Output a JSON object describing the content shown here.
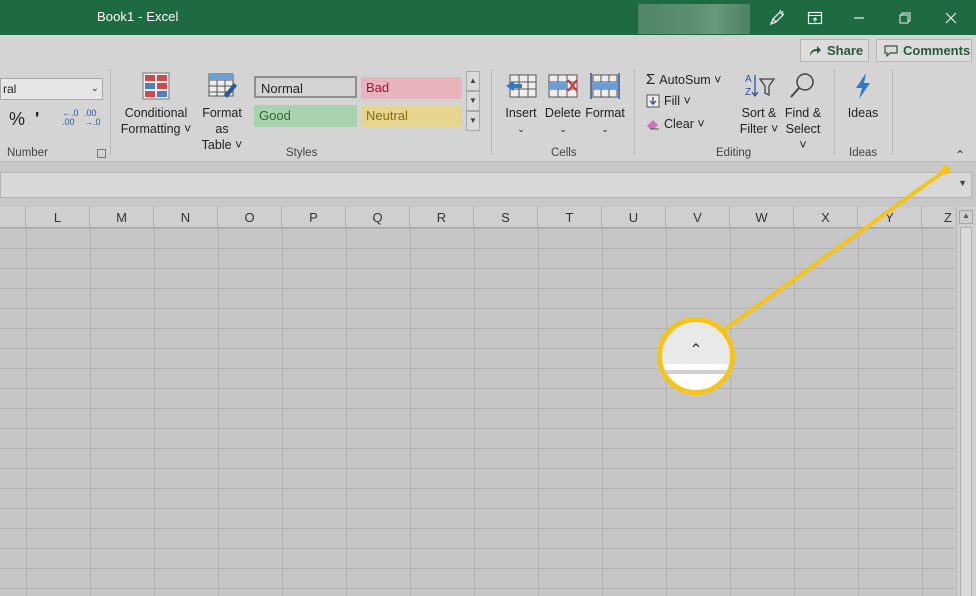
{
  "window": {
    "title": "Book1  -  Excel",
    "controls": {
      "minimize": "minimize",
      "restore": "restore",
      "close": "close"
    }
  },
  "ribbon_top": {
    "share_label": "Share",
    "comments_label": "Comments"
  },
  "ribbon": {
    "number": {
      "format_value": "ral",
      "percent": "%",
      "comma": "'",
      "increase_decimal": "←.0\n.00",
      "decrease_decimal": ".00\n→.0",
      "label": "Number"
    },
    "styles": {
      "conditional_formatting": "Conditional\nFormatting ˅",
      "format_as_table": "Format as\nTable ˅",
      "cells": [
        {
          "label": "Normal",
          "color": "#e6e6e6",
          "text_color": "#222222"
        },
        {
          "label": "Bad",
          "color": "#e7b3bc",
          "text_color": "#9c1c3a"
        },
        {
          "label": "Good",
          "color": "#a9d3ae",
          "text_color": "#2c6b2f"
        },
        {
          "label": "Neutral",
          "color": "#e5d58f",
          "text_color": "#8a6a10"
        }
      ],
      "label": "Styles"
    },
    "cells": {
      "insert": "Insert",
      "delete": "Delete",
      "format": "Format",
      "label": "Cells"
    },
    "editing": {
      "autosum": "AutoSum ˅",
      "fill": "Fill ˅",
      "clear": "Clear ˅",
      "sort_filter": "Sort &\nFilter ˅",
      "find_select": "Find &\nSelect ˅",
      "label": "Editing"
    },
    "ideas": {
      "ideas": "Ideas",
      "label": "Ideas"
    }
  },
  "columns": [
    "L",
    "M",
    "N",
    "O",
    "P",
    "Q",
    "R",
    "S",
    "T",
    "U",
    "V",
    "W",
    "X",
    "Y",
    "Z"
  ],
  "colors": {
    "title_bar": "#1e6b41",
    "callout": "#f5c419",
    "accent_blue": "#2b579a"
  }
}
